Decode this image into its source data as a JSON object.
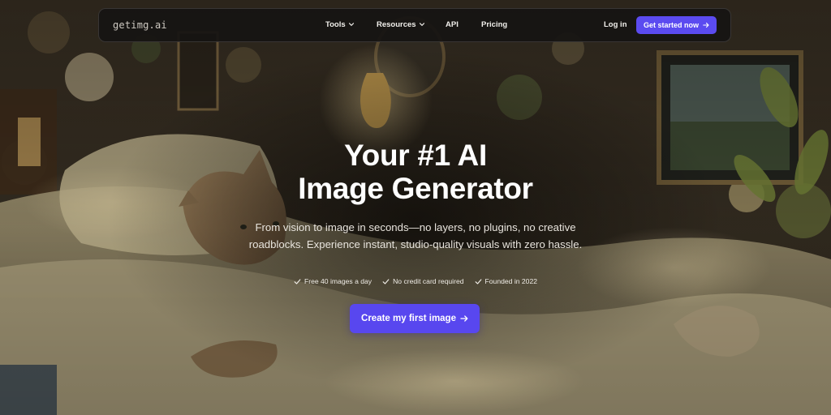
{
  "nav": {
    "logo": "getimg.ai",
    "links": [
      {
        "label": "Tools",
        "has_dropdown": true,
        "icon": "chevron-down-icon"
      },
      {
        "label": "Resources",
        "has_dropdown": true,
        "icon": "chevron-down-icon"
      },
      {
        "label": "API",
        "has_dropdown": false
      },
      {
        "label": "Pricing",
        "has_dropdown": false
      }
    ],
    "login_label": "Log in",
    "cta_label": "Get started now",
    "cta_icon": "arrow-right-icon"
  },
  "hero": {
    "title_line1": "Your #1 AI",
    "title_line2": "Image Generator",
    "subtitle": "From vision to image in seconds—no layers, no plugins, no creative roadblocks. Experience instant, studio-quality visuals with zero hassle.",
    "bullets": [
      {
        "text": "Free 40 images a day",
        "icon": "check-icon"
      },
      {
        "text": "No credit card required",
        "icon": "check-icon"
      },
      {
        "text": "Founded in 2022",
        "icon": "check-icon"
      }
    ],
    "cta_label": "Create my first image",
    "cta_icon": "arrow-right-icon"
  },
  "colors": {
    "accent": "#5847ef",
    "nav_bg": "#161412",
    "text": "#ffffff"
  }
}
